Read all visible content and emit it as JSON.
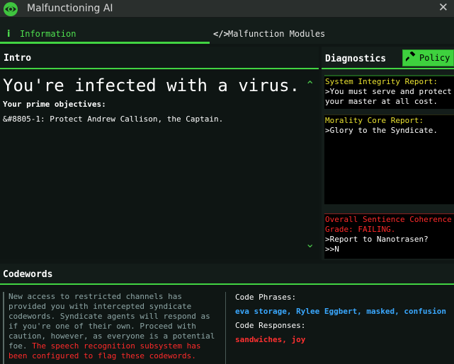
{
  "window": {
    "title": "Malfunctioning AI",
    "close_glyph": "✕"
  },
  "tabs": [
    {
      "label": "Information",
      "icon": "info-icon",
      "glyph": "i",
      "active": true
    },
    {
      "label": "Malfunction Modules",
      "icon": "code-icon",
      "glyph": "</>",
      "active": false
    }
  ],
  "intro": {
    "title": "Intro",
    "headline": "You're infected with a virus.",
    "objectives_title": "Your prime objectives:",
    "objectives": [
      "&#8805-1: Protect Andrew Callison, the Captain."
    ],
    "scroll_up_glyph": "⌃",
    "scroll_down_glyph": "⌄"
  },
  "diagnostics": {
    "title": "Diagnostics",
    "policy_button": {
      "label": "Policy",
      "icon": "gavel-icon",
      "glyph": "🔨"
    },
    "system_integrity": {
      "title": "System Integrity Report:",
      "lines": [
        ">You must serve and protect",
        "your master at all cost."
      ]
    },
    "morality_core": {
      "title": "Morality Core Report:",
      "lines": [
        ">Glory to the Syndicate."
      ]
    },
    "sentience": {
      "title": "Overall Sentience Coherence",
      "grade": "Grade: FAILING.",
      "lines": [
        ">Report to Nanotrasen?",
        ">>N"
      ]
    }
  },
  "codewords": {
    "title": "Codewords",
    "description": "New access to restricted channels has provided you with intercepted syndicate codewords. Syndicate agents will respond as if you're one of their own. Proceed with caution, however, as everyone is a potential foe.",
    "warning": "The speech recognition subsystem has been configured to flag these codewords.",
    "phrases_label": "Code Phrases:",
    "phrases": "eva storage, Rylee Eggbert, masked, confusion",
    "responses_label": "Code Responses:",
    "responses": "sandwiches, joy"
  },
  "colors": {
    "accent_green": "#42d442",
    "warning_red": "#ff2a2a",
    "report_yellow": "#e8e030",
    "phrase_blue": "#3aa8ff"
  }
}
